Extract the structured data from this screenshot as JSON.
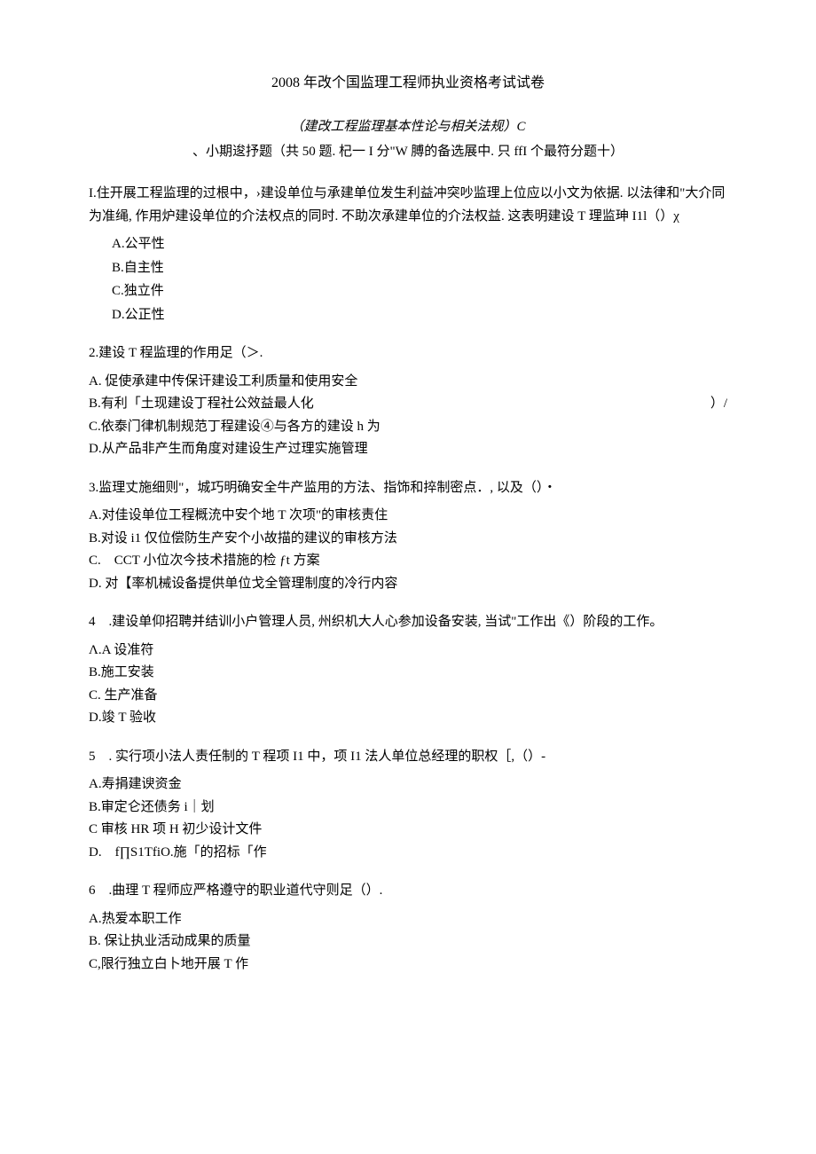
{
  "title": "2008 年改个国监理工程师执业资格考试试卷",
  "subtitle": "（建改工程监理基本性论与相关法规）C",
  "instruction": "、小期逡抒题（共 50 题. 杞一 I 分\"W 膊的备选展中. 只 ffI 个最符分题十）",
  "q1": {
    "stem": "I.住开展工程监理的过根中，›建设单位与承建单位发生利益冲突吵监理上位应以小文为依据. 以法律和\"大介同为准绳, 作用炉建设单位的介法权点的同时. 不助次承建单位的介法权益. 这表明建设 T 理监珅 I1l（）χ",
    "a": "A.公平性",
    "b": "B.自主性",
    "c": "C.独立件",
    "d": "D.公正性"
  },
  "q2": {
    "stem": "2.建设 T 程监理的作用足（＞.",
    "a": "A. 促使承建中传保讦建设工利质量和使用安全",
    "b": "B.有利「土现建设丁程社公效益最人化",
    "b_right": "）/",
    "c": "C.依泰门律机制规范丁程建设④与各方的建设 h 为",
    "d": "D.从产品非产生而角度对建设生产过理实施管理"
  },
  "q3": {
    "stem": "3.监理丈施细则\"，城巧明确安全牛产监用的方法、指饰和捽制密点．, 以及（）・",
    "a": "A.对佳设单位工程概㳘中安个地 T 次项\"的审核责住",
    "b": "B.对设 i1 仅位偿防生产安个小故描的建议的审核方法",
    "c": "C.　CCT 小位次今技术措施的检 ƒt 方案",
    "d": "D. 对【率机械设备提供单位戈全管理制度的冷行内容"
  },
  "q4": {
    "stem": "4　.建设单仰招聘并结训小户管理人员, 州织机大人心参加设备安装, 当试\"工作出《）阶段的工作。",
    "a": "Λ.A 设准符",
    "b": "B.施工安装",
    "c": "C. 生产准备",
    "d": "D.竣 T 验收"
  },
  "q5": {
    "stem": "5　. 实行项小法人责任制的 T 程项 I1 中，项 I1 法人单位总经理的职权［,（）-",
    "a": "A.寿捐建谀资金",
    "b": "B.审定仑还债务 i｜划",
    "c": "C 审核 HR 项 H 初少设计文件",
    "d": "D.　f∏S1TfiO.施「的招标「作"
  },
  "q6": {
    "stem": "6　.曲理 T 程师应严格遵守的职业道代守则足（）.",
    "a": "A.热爱本职工作",
    "b": "B. 保让执业活动成果的质量",
    "c": "C,限行独立白卜地开展 T 作"
  }
}
